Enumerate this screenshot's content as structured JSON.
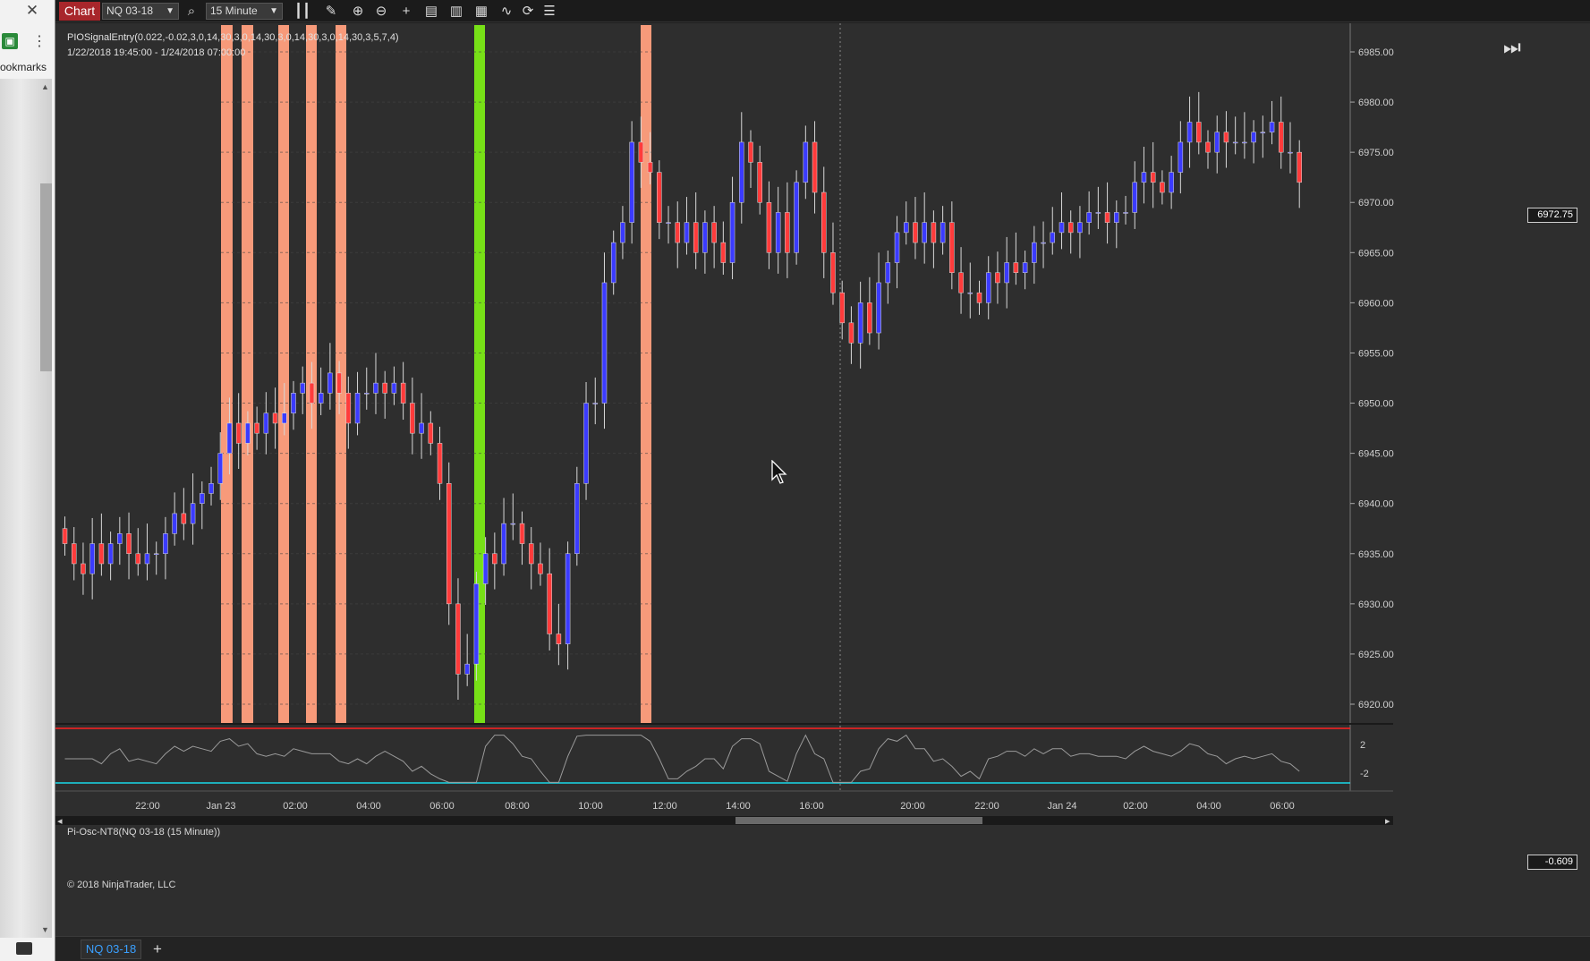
{
  "browser": {
    "close_glyph": "✕",
    "bookmarks_label": "ookmarks"
  },
  "toolbar": {
    "chart_tab": "Chart",
    "instrument": "NQ 03-18",
    "interval": "15 Minute",
    "icons": [
      "search-icon",
      "bar-type-icon",
      "draw-icon",
      "zoom-in-icon",
      "zoom-out-icon",
      "crosshair-icon",
      "data-box-icon",
      "strategy-icon",
      "chart-trader-icon",
      "indicators-icon",
      "reload-icon",
      "properties-icon"
    ]
  },
  "chart": {
    "indicator_title": "PIOSignalEntry(0.022,-0.02,3,0,14,30,3,0,14,30,3,0,14,30,3,0,14,30,3,5,7,4)",
    "date_range": "1/22/2018 19:45:00 - 1/24/2018 07:00:00",
    "oscillator_title": "Pi-Osc-NT8(NQ 03-18 (15 Minute))",
    "copyright": "© 2018 NinjaTrader, LLC",
    "last_price": "6972.75",
    "osc_value": "-0.609",
    "price_ticks": [
      "6985.00",
      "6980.00",
      "6975.00",
      "6970.00",
      "6965.00",
      "6960.00",
      "6955.00",
      "6950.00",
      "6945.00",
      "6940.00",
      "6935.00",
      "6930.00",
      "6925.00",
      "6920.00"
    ],
    "osc_ticks": [
      "2",
      "-2"
    ],
    "time_ticks": [
      "22:00",
      "Jan 23",
      "02:00",
      "04:00",
      "06:00",
      "08:00",
      "10:00",
      "12:00",
      "14:00",
      "16:00",
      "20:00",
      "22:00",
      "Jan 24",
      "02:00",
      "04:00",
      "06:00"
    ],
    "colors": {
      "up": "#3b3bff",
      "down": "#ff3b3b",
      "signal_sell": "#f79a7a",
      "signal_buy": "#77e017",
      "background": "#2e2e2e",
      "osc_line": "#9a9a9a",
      "osc_upper": "#ff2020",
      "osc_lower": "#19d8e8"
    }
  },
  "bottom": {
    "instrument_tab": "NQ 03-18",
    "add_tab": "+"
  }
}
